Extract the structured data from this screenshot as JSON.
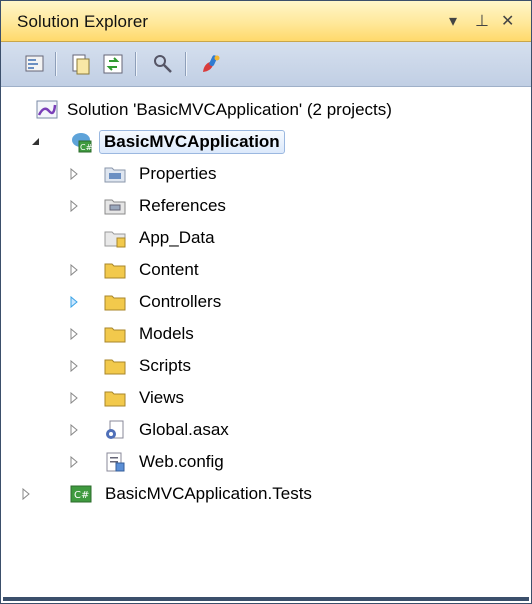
{
  "panel": {
    "title": "Solution Explorer",
    "buttons": {
      "dropdown": "▾",
      "pin": "⊥",
      "close": "✕"
    }
  },
  "toolbar": {
    "icons": [
      "properties-icon",
      "show-all-files-icon",
      "refresh-icon",
      "view-class-diagram-icon",
      "paint-brush-icon"
    ]
  },
  "tree": {
    "solution": "Solution 'BasicMVCApplication' (2 projects)",
    "project": "BasicMVCApplication",
    "items": [
      {
        "label": "Properties",
        "icon": "properties-folder-icon",
        "expandable": true
      },
      {
        "label": "References",
        "icon": "references-icon",
        "expandable": true
      },
      {
        "label": "App_Data",
        "icon": "folder-icon",
        "expandable": false
      },
      {
        "label": "Content",
        "icon": "folder-icon",
        "expandable": true
      },
      {
        "label": "Controllers",
        "icon": "folder-icon",
        "expandable": true,
        "highlight_arrow": true
      },
      {
        "label": "Models",
        "icon": "folder-icon",
        "expandable": true
      },
      {
        "label": "Scripts",
        "icon": "folder-icon",
        "expandable": true
      },
      {
        "label": "Views",
        "icon": "folder-icon",
        "expandable": true
      },
      {
        "label": "Global.asax",
        "icon": "asax-file-icon",
        "expandable": true
      },
      {
        "label": "Web.config",
        "icon": "config-file-icon",
        "expandable": true
      }
    ],
    "test_project": "BasicMVCApplication.Tests"
  },
  "colors": {
    "title_bar": "#ffe89a",
    "toolbar": "#c9d6ea",
    "selection": "#dce9fb",
    "folder": "#f2c94c"
  }
}
